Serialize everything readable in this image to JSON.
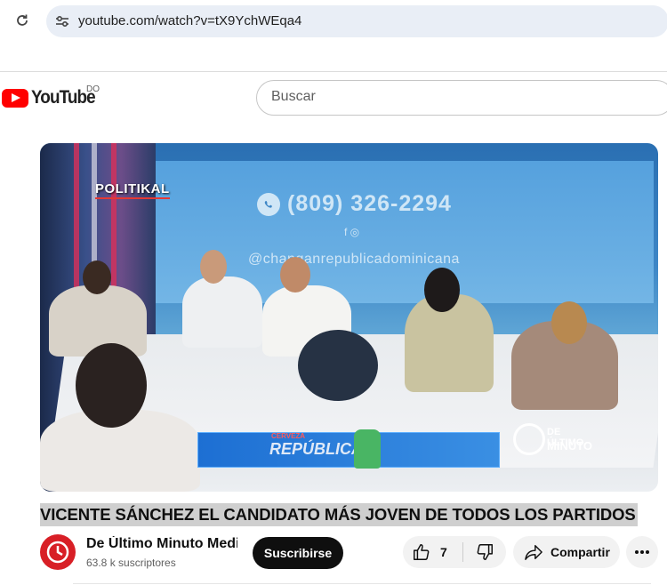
{
  "browser": {
    "url": "youtube.com/watch?v=tX9YchWEqa4",
    "reload_icon": "reload-icon",
    "site_info_icon": "tune-icon"
  },
  "header": {
    "logo_text": "YouTube",
    "country_code": "DO",
    "search_placeholder": "Buscar"
  },
  "video": {
    "overlay_brand": "POLITIKAL",
    "overlay_phone": "(809) 326-2294",
    "overlay_handle": "@changanrepublicadominicana",
    "banner_text": "REPÚBLICA",
    "banner_small": "CERVEZA",
    "logo_line1": "DE ÚLTIMO",
    "logo_line2": "MINUTO"
  },
  "title": "VICENTE SÁNCHEZ EL CANDIDATO MÁS JOVEN DE TODOS LOS PARTIDOS",
  "channel": {
    "name": "De Último Minuto Medi",
    "subscribers": "63.8 k suscriptores",
    "subscribe_label": "Suscribirse"
  },
  "actions": {
    "like_count": "7",
    "share_label": "Compartir"
  },
  "colors": {
    "brand_red": "#ff0000",
    "subscribe_bg": "#0f0f0f",
    "chip_bg": "#f2f2f2"
  }
}
